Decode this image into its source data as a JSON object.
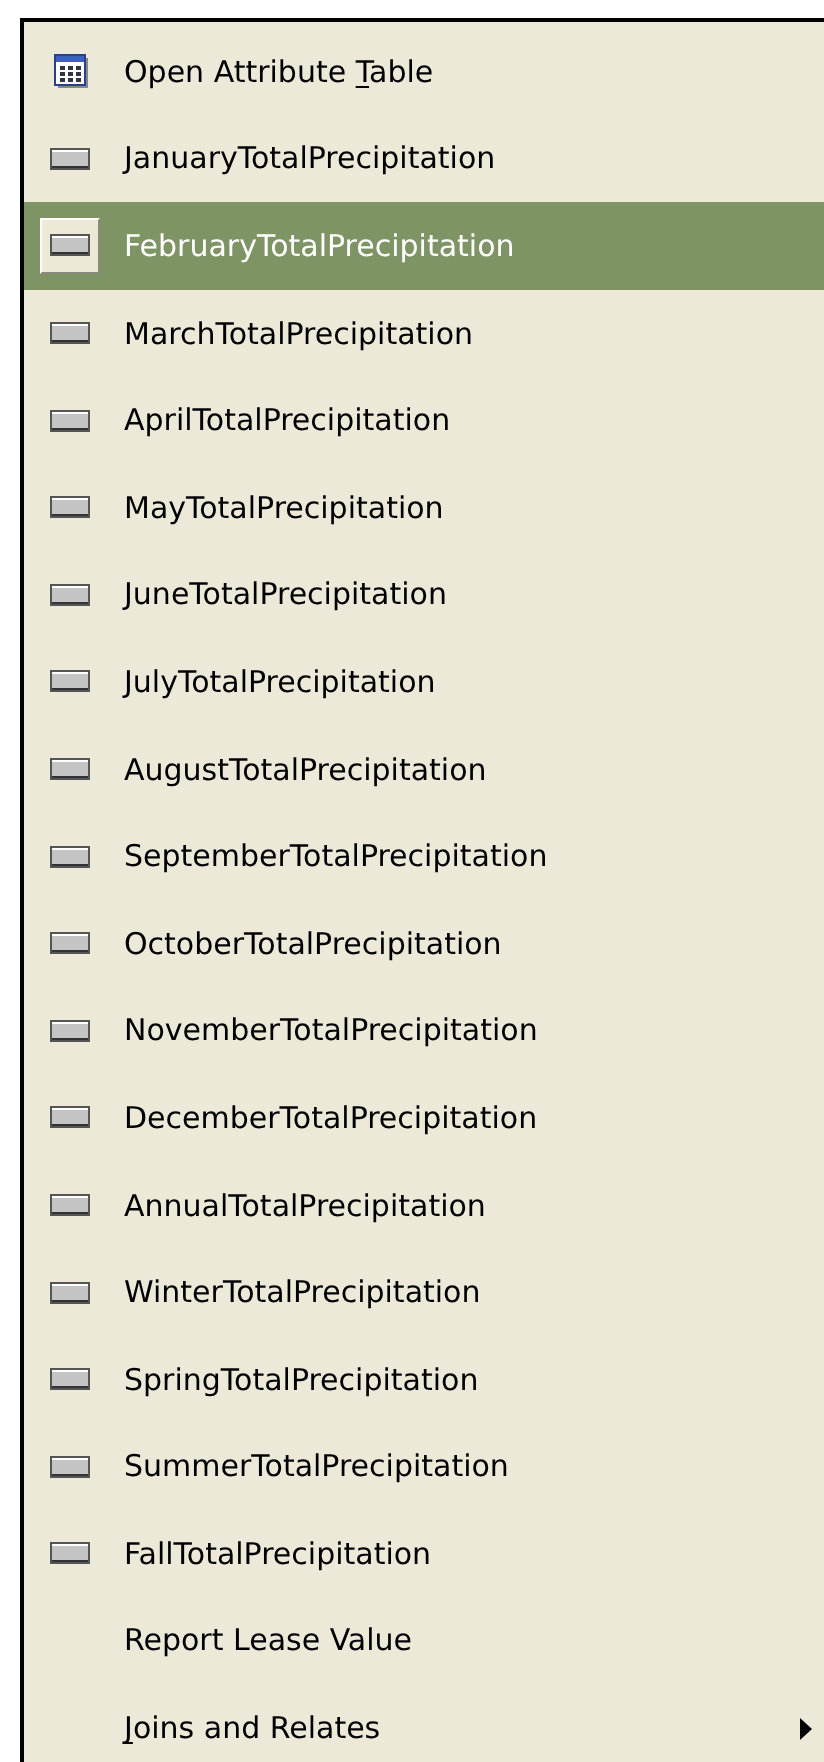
{
  "menu": {
    "items": [
      {
        "kind": "table",
        "label_parts": [
          {
            "text": "Open Attribute ",
            "underline": false
          },
          {
            "text": "T",
            "underline": true
          },
          {
            "text": "able",
            "underline": false
          }
        ],
        "selected": false
      },
      {
        "kind": "layer",
        "label": "JanuaryTotalPrecipitation",
        "selected": false
      },
      {
        "kind": "layer",
        "label": "FebruaryTotalPrecipitation",
        "selected": true
      },
      {
        "kind": "layer",
        "label": "MarchTotalPrecipitation",
        "selected": false
      },
      {
        "kind": "layer",
        "label": "AprilTotalPrecipitation",
        "selected": false
      },
      {
        "kind": "layer",
        "label": "MayTotalPrecipitation",
        "selected": false
      },
      {
        "kind": "layer",
        "label": "JuneTotalPrecipitation",
        "selected": false
      },
      {
        "kind": "layer",
        "label": "JulyTotalPrecipitation",
        "selected": false
      },
      {
        "kind": "layer",
        "label": "AugustTotalPrecipitation",
        "selected": false
      },
      {
        "kind": "layer",
        "label": "SeptemberTotalPrecipitation",
        "selected": false
      },
      {
        "kind": "layer",
        "label": "OctoberTotalPrecipitation",
        "selected": false
      },
      {
        "kind": "layer",
        "label": "NovemberTotalPrecipitation",
        "selected": false
      },
      {
        "kind": "layer",
        "label": "DecemberTotalPrecipitation",
        "selected": false
      },
      {
        "kind": "layer",
        "label": "AnnualTotalPrecipitation",
        "selected": false
      },
      {
        "kind": "layer",
        "label": "WinterTotalPrecipitation",
        "selected": false
      },
      {
        "kind": "layer",
        "label": "SpringTotalPrecipitation",
        "selected": false
      },
      {
        "kind": "layer",
        "label": "SummerTotalPrecipitation",
        "selected": false
      },
      {
        "kind": "layer",
        "label": "FallTotalPrecipitation",
        "selected": false
      },
      {
        "kind": "plain",
        "label": "Report Lease Value",
        "selected": false
      },
      {
        "kind": "submenu",
        "label_parts": [
          {
            "text": "J",
            "underline": true
          },
          {
            "text": "oins and Relates",
            "underline": false
          }
        ],
        "selected": false
      }
    ]
  }
}
